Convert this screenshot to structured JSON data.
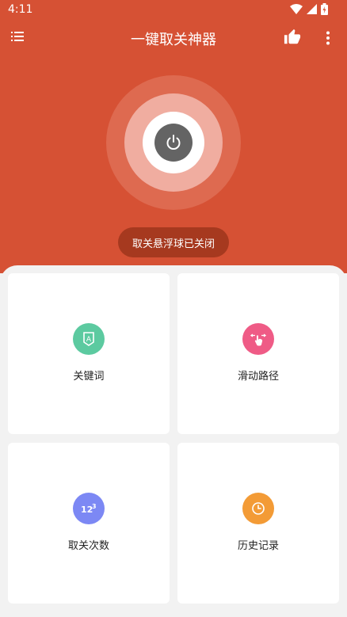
{
  "statusbar": {
    "time": "4:11"
  },
  "toolbar": {
    "title": "一键取关神器"
  },
  "main": {
    "toggle_label": "取关悬浮球已关闭"
  },
  "cards": [
    {
      "label": "关键词",
      "icon": "keyword-a-icon",
      "color": "#5ccaa0"
    },
    {
      "label": "滑动路径",
      "icon": "swipe-hand-icon",
      "color": "#ef5b86"
    },
    {
      "label": "取关次数",
      "icon": "count-123-icon",
      "color": "#7c88f4"
    },
    {
      "label": "历史记录",
      "icon": "clock-icon",
      "color": "#f39b36"
    }
  ],
  "colors": {
    "accent": "#d65134",
    "toggle_bg": "#a6391f",
    "power": "#646464"
  }
}
